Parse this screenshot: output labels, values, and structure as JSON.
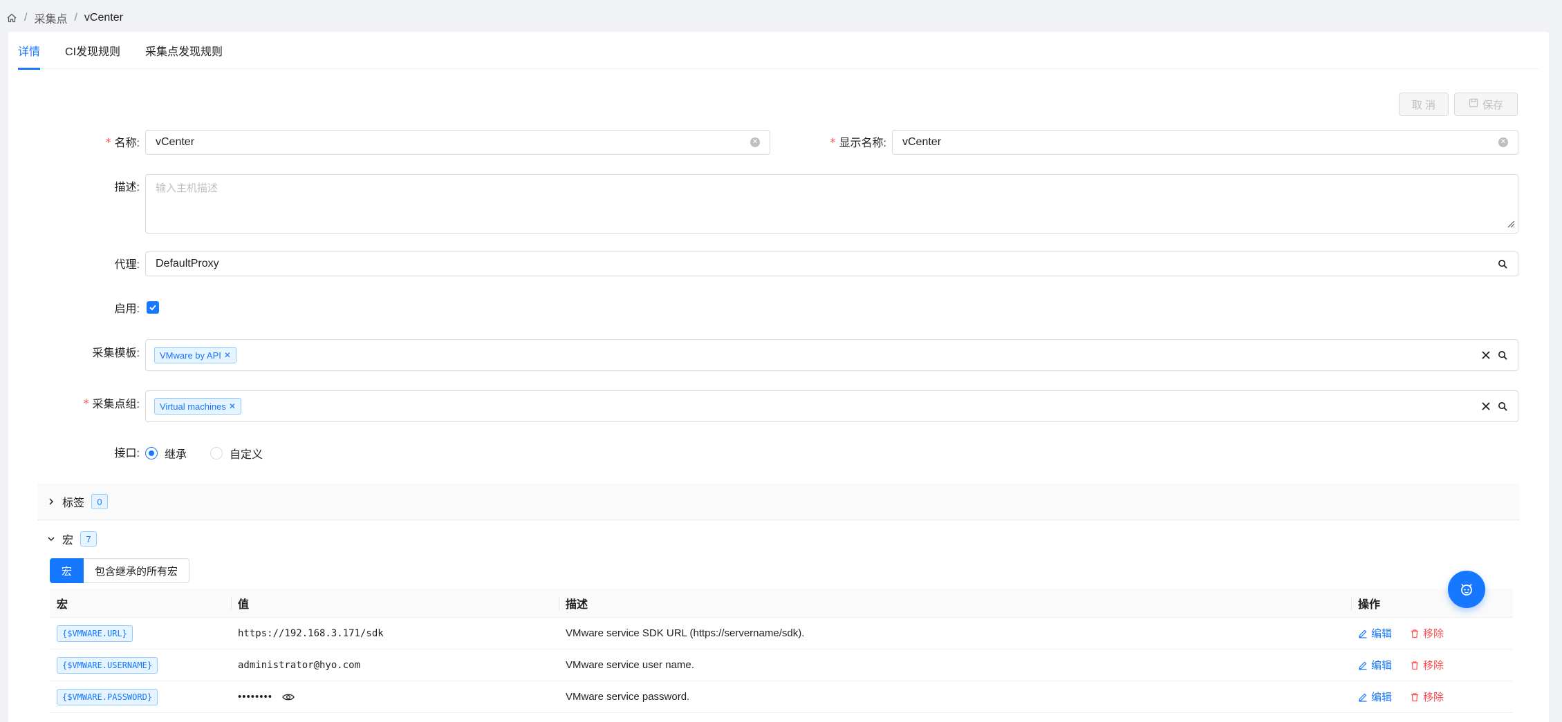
{
  "breadcrumb": {
    "items": [
      "采集点",
      "vCenter"
    ],
    "separator": "/"
  },
  "tabs": [
    {
      "label": "详情",
      "active": true
    },
    {
      "label": "CI发现规则",
      "active": false
    },
    {
      "label": "采集点发现规则",
      "active": false
    }
  ],
  "toolbar": {
    "cancel_label": "取 消",
    "save_label": "保存"
  },
  "form": {
    "name": {
      "label": "名称:",
      "value": "vCenter",
      "required": true
    },
    "display_name": {
      "label": "显示名称:",
      "value": "vCenter",
      "required": true
    },
    "description": {
      "label": "描述:",
      "placeholder": "输入主机描述"
    },
    "proxy": {
      "label": "代理:",
      "value": "DefaultProxy"
    },
    "enabled": {
      "label": "启用:",
      "checked": true
    },
    "template": {
      "label": "采集模板:",
      "tags": [
        "VMware by API"
      ]
    },
    "group": {
      "label": "采集点组:",
      "required": true,
      "tags": [
        "Virtual machines"
      ]
    },
    "interface": {
      "label": "接口:",
      "options": [
        "继承",
        "自定义"
      ],
      "selected": "继承"
    }
  },
  "sections": {
    "tags": {
      "label": "标签",
      "count": "0",
      "expanded": false
    },
    "macros": {
      "label": "宏",
      "count": "7",
      "expanded": true
    }
  },
  "macro_tabs": [
    "宏",
    "包含继承的所有宏"
  ],
  "macro_table": {
    "headers": [
      "宏",
      "值",
      "描述",
      "操作"
    ],
    "edit_label": "编辑",
    "remove_label": "移除",
    "rows": [
      {
        "macro": "{$VMWARE.URL}",
        "value": "https://192.168.3.171/sdk",
        "description": "VMware service SDK URL (https://servername/sdk)."
      },
      {
        "macro": "{$VMWARE.USERNAME}",
        "value": "administrator@hyo.com",
        "description": "VMware service user name."
      },
      {
        "macro": "{$VMWARE.PASSWORD}",
        "value": "••••••••",
        "description": "VMware service password."
      }
    ]
  },
  "colors": {
    "accent": "#1677ff",
    "danger": "#ff4d4f",
    "border": "#d9d9d9"
  }
}
